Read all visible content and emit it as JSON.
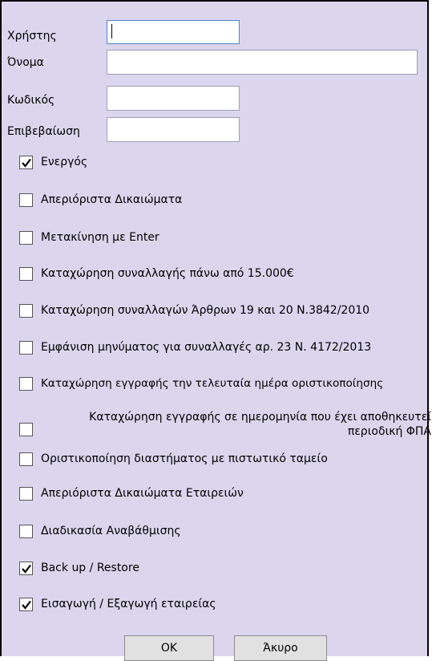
{
  "fields": {
    "user_label": "Χρήστης",
    "user_value": "",
    "name_label": "Όνομα",
    "name_value": "",
    "password_label": "Κωδικός",
    "password_value": "",
    "confirm_label": "Επιβεβαίωση",
    "confirm_value": ""
  },
  "checkboxes": [
    {
      "label": "Ενεργός",
      "checked": true
    },
    {
      "label": "Απεριόριστα Δικαιώματα",
      "checked": false
    },
    {
      "label": "Μετακίνηση με Enter",
      "checked": false
    },
    {
      "label": "Καταχώρηση συναλλαγής  πάνω από 15.000€",
      "checked": false
    },
    {
      "label": "Καταχώρηση συναλλαγών Άρθρων  19 και 20 Ν.3842/2010",
      "checked": false
    },
    {
      "label": "Εμφάνιση μηνύματος για συναλλαγές αρ. 23  Ν. 4172/2013",
      "checked": false
    },
    {
      "label": "Καταχώρηση εγγραφής την τελευταία ημέρα οριστικοποίησης",
      "checked": false
    },
    {
      "label_line1": "Καταχώρηση εγγραφής σε ημερομηνία που έχει αποθηκευτεί",
      "label_line2": "περιοδική ΦΠΑ",
      "checked": false
    },
    {
      "label": "Οριστικοποίηση διαστήματος με πιστωτικό ταμείο",
      "checked": false
    },
    {
      "label": "Απεριόριστα Δικαιώματα Εταιρειών",
      "checked": false
    },
    {
      "label": "Διαδικασία Αναβάθμισης",
      "checked": false
    },
    {
      "label": "Back up / Restore",
      "checked": true
    },
    {
      "label": "Εισαγωγή / Εξαγωγή εταιρείας",
      "checked": true
    }
  ],
  "buttons": {
    "ok": "OK",
    "cancel": "Άκυρο"
  }
}
